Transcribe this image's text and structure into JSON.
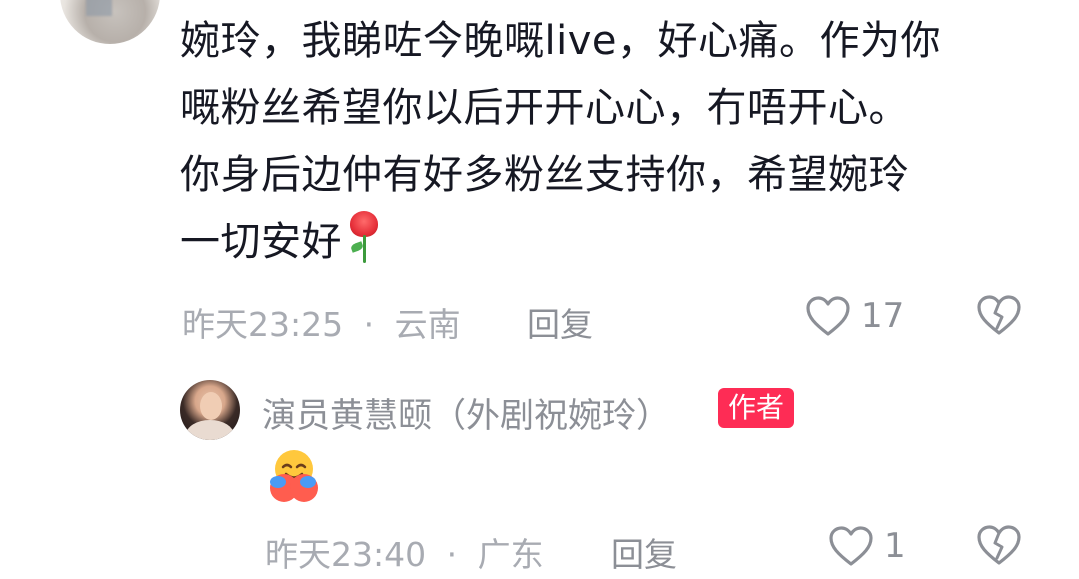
{
  "comment": {
    "lines": [
      "婉玲，我睇咗今晚嘅live，好心痛。作为你",
      "嘅粉丝希望你以后开开心心，冇唔开心。",
      "你身后边仲有好多粉丝支持你，希望婉玲",
      "一切安好"
    ],
    "emoji": "rose-emoji",
    "time": "昨天23:25",
    "separator": "·",
    "location": "云南",
    "reply_label": "回复",
    "like_count": "17"
  },
  "reply": {
    "author_name": "演员黄慧颐（外剧祝婉玲）",
    "badge": "作者",
    "emoji": "hugging-face-emoji",
    "time": "昨天23:40",
    "separator": "·",
    "location": "广东",
    "reply_label": "回复",
    "like_count": "1"
  },
  "colors": {
    "text": "#161823",
    "meta": "#a8abb2",
    "secondary": "#8c8f96",
    "badge": "#fe2c55",
    "background": "#ffffff"
  },
  "icons": {
    "like": "heart-outline-icon",
    "dislike": "broken-heart-icon"
  }
}
